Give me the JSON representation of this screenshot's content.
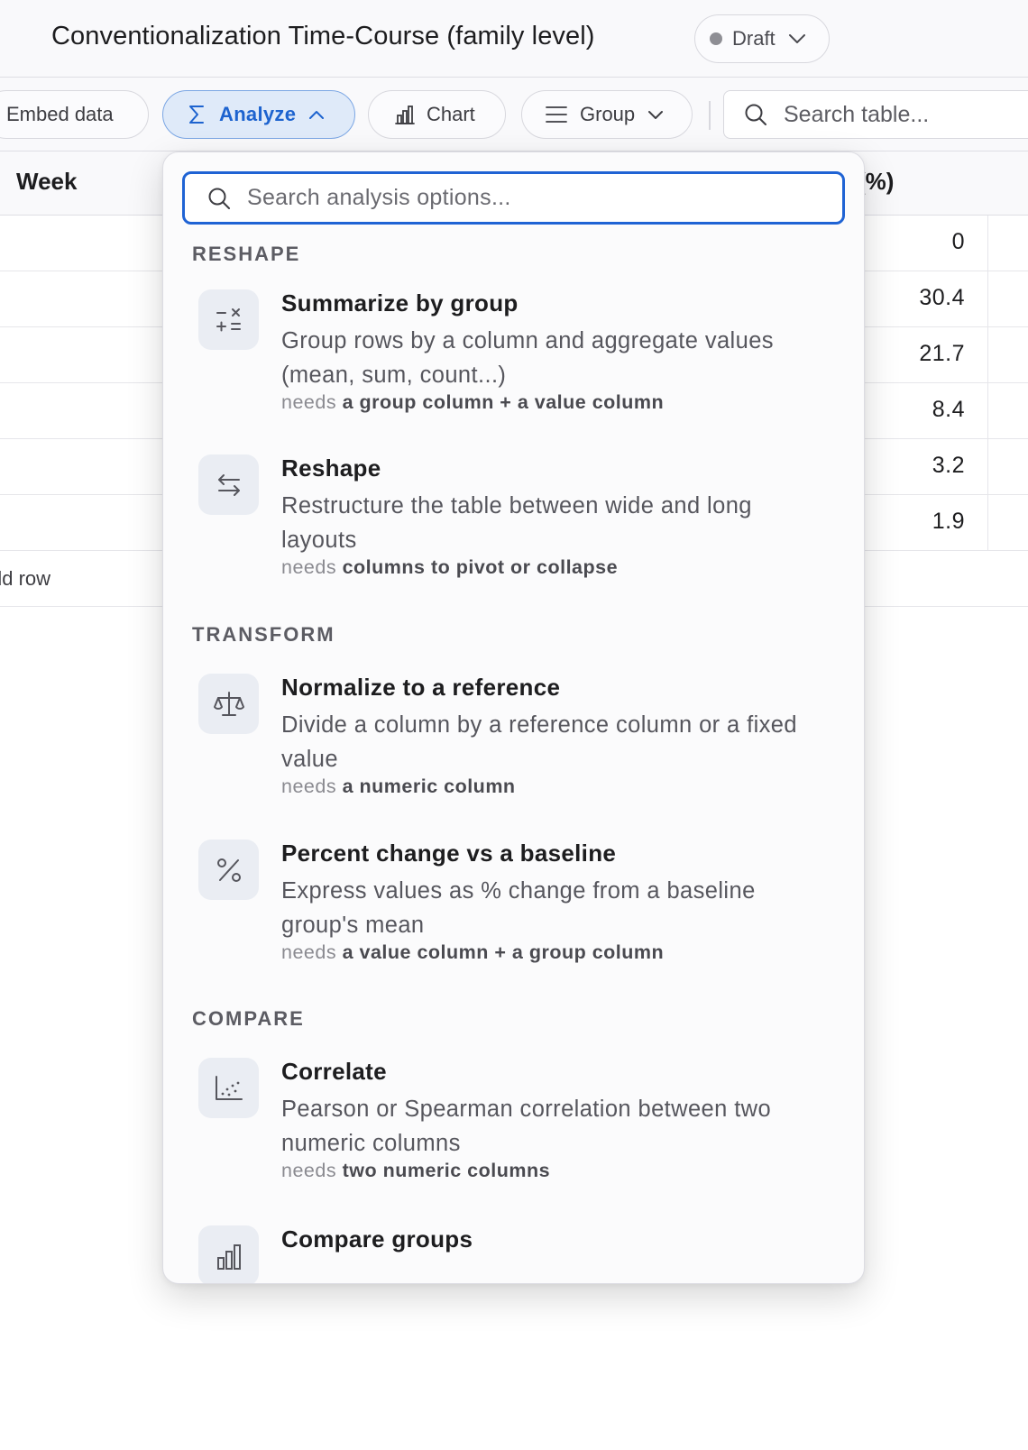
{
  "header": {
    "title": "Conventionalization Time-Course (family level)",
    "status": "Draft"
  },
  "toolbar": {
    "embed_label": "Embed data",
    "analyze_label": "Analyze",
    "chart_label": "Chart",
    "group_label": "Group",
    "search_placeholder": "Search table..."
  },
  "table": {
    "col_week": "Week",
    "col_pct": "(%)",
    "rows": [
      "0",
      "30.4",
      "21.7",
      "8.4",
      "3.2",
      "1.9"
    ],
    "add_row_label": "dd row"
  },
  "analyze_menu": {
    "search_placeholder": "Search analysis options...",
    "needs_prefix": "needs",
    "sections": [
      {
        "label": "RESHAPE",
        "options": [
          {
            "name": "Summarize by group",
            "desc": "Group rows by a column and aggregate values (mean, sum, count...)",
            "needs": "a group column + a value column",
            "icon": "calculator-icon"
          },
          {
            "name": "Reshape",
            "desc": "Restructure the table between wide and long layouts",
            "needs": "columns to pivot or collapse",
            "icon": "swap-arrows-icon"
          }
        ]
      },
      {
        "label": "TRANSFORM",
        "options": [
          {
            "name": "Normalize to a reference",
            "desc": "Divide a column by a reference column or a fixed value",
            "needs": "a numeric column",
            "icon": "scale-icon"
          },
          {
            "name": "Percent change vs a baseline",
            "desc": "Express values as % change from a baseline group's mean",
            "needs": "a value column + a group column",
            "icon": "percent-icon"
          }
        ]
      },
      {
        "label": "COMPARE",
        "options": [
          {
            "name": "Correlate",
            "desc": "Pearson or Spearman correlation between two numeric columns",
            "needs": "two numeric columns",
            "icon": "scatter-plot-icon"
          },
          {
            "name": "Compare groups",
            "icon": "bar-chart-icon"
          }
        ]
      }
    ]
  },
  "colors": {
    "accent": "#1f63d4",
    "accent_bg": "#dfeaf9",
    "tile_bg": "#eaedf3"
  }
}
